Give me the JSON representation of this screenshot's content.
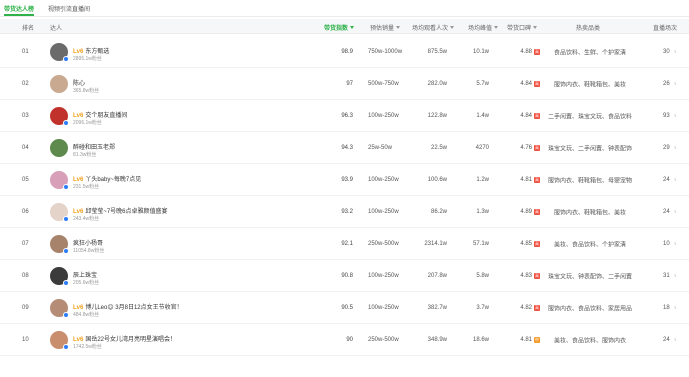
{
  "tabs": [
    {
      "label": "带货达人榜",
      "active": true
    },
    {
      "label": "视频引流直播间",
      "active": false
    }
  ],
  "columns": {
    "rank": "排名",
    "streamer": "达人",
    "score": "带货指数",
    "sales": "预估销量",
    "viewers": "场均观看人次",
    "peak": "场均峰值",
    "reputation": "带货口碑",
    "category": "热卖品类",
    "lives": "直播场次"
  },
  "colors": {
    "accent": "#2fb24a",
    "level": "#f3a01c",
    "rep_high": "#ef4d3c",
    "rep_mid": "#f39b2b",
    "verified": "#2b7cff"
  },
  "chevron": "›",
  "rows": [
    {
      "rank": "01",
      "level": "Lv6",
      "name": "东方甄选",
      "fans": "2895.1w粉丝",
      "score": "98.9",
      "sales": "750w-1000w",
      "viewers": "875.5w",
      "peak": "10.1w",
      "rep": "4.88",
      "rep_tag": "高",
      "category": "食品饮料、生鲜、个护家清",
      "lives": "30",
      "avatar_color": "#6b6b6b",
      "verified": true
    },
    {
      "rank": "02",
      "level": "",
      "name": "陈心",
      "fans": "365.8w粉丝",
      "score": "97",
      "sales": "500w-750w",
      "viewers": "282.0w",
      "peak": "5.7w",
      "rep": "4.84",
      "rep_tag": "高",
      "category": "服饰内衣、鞋靴箱包、美妆",
      "lives": "26",
      "avatar_color": "#c9a98f",
      "verified": false
    },
    {
      "rank": "03",
      "level": "Lv6",
      "name": "交个朋友直播间",
      "fans": "2096.1w粉丝",
      "score": "96.3",
      "sales": "100w-250w",
      "viewers": "122.8w",
      "peak": "1.4w",
      "rep": "4.84",
      "rep_tag": "高",
      "category": "二手闲置、珠宝文玩、食品饮料",
      "lives": "93",
      "avatar_color": "#c0322b",
      "verified": true
    },
    {
      "rank": "04",
      "level": "",
      "name": "醉碰和田玉老郑",
      "fans": "81.3w粉丝",
      "score": "94.3",
      "sales": "25w-50w",
      "viewers": "22.5w",
      "peak": "4270",
      "rep": "4.76",
      "rep_tag": "高",
      "category": "珠宝文玩、二手闲置、钟表配饰",
      "lives": "29",
      "avatar_color": "#5e8a4e",
      "verified": false
    },
    {
      "rank": "05",
      "level": "Lv6",
      "name": "丫头baby~每晚7点见",
      "fans": "231.5w粉丝",
      "score": "93.9",
      "sales": "100w-250w",
      "viewers": "100.6w",
      "peak": "1.2w",
      "rep": "4.81",
      "rep_tag": "高",
      "category": "服饰内衣、鞋靴箱包、母婴宠物",
      "lives": "24",
      "avatar_color": "#d8a0b8",
      "verified": true
    },
    {
      "rank": "06",
      "level": "Lv6",
      "name": "邱莹莹~7号晚6点卓雅颜值盛宴",
      "fans": "243.4w粉丝",
      "score": "93.2",
      "sales": "100w-250w",
      "viewers": "86.2w",
      "peak": "1.3w",
      "rep": "4.89",
      "rep_tag": "高",
      "category": "服饰内衣、鞋靴箱包、美妆",
      "lives": "24",
      "avatar_color": "#e3d3c8",
      "verified": true
    },
    {
      "rank": "07",
      "level": "",
      "name": "疯狂小杨哥",
      "fans": "11054.8w粉丝",
      "score": "92.1",
      "sales": "250w-500w",
      "viewers": "2314.1w",
      "peak": "57.1w",
      "rep": "4.85",
      "rep_tag": "高",
      "category": "美妆、食品饮料、个护家清",
      "lives": "10",
      "avatar_color": "#a7836b",
      "verified": true
    },
    {
      "rank": "08",
      "level": "",
      "name": "辰上珠宝",
      "fans": "205.6w粉丝",
      "score": "90.8",
      "sales": "100w-250w",
      "viewers": "207.8w",
      "peak": "5.8w",
      "rep": "4.83",
      "rep_tag": "高",
      "category": "珠宝文玩、钟表配饰、二手闲置",
      "lives": "31",
      "avatar_color": "#3b3b3b",
      "verified": true
    },
    {
      "rank": "09",
      "level": "Lv6",
      "name": "博儿Leo😊 3月8日12点女王节收官！",
      "fans": "484.8w粉丝",
      "score": "90.5",
      "sales": "100w-250w",
      "viewers": "382.7w",
      "peak": "3.7w",
      "rep": "4.82",
      "rep_tag": "高",
      "category": "服饰内衣、食品饮料、家居用品",
      "lives": "18",
      "avatar_color": "#b58d77",
      "verified": true
    },
    {
      "rank": "10",
      "level": "Lv6",
      "name": "国岳22号女儿湾月亮明星演唱会！",
      "fans": "1742.5w粉丝",
      "score": "90",
      "sales": "250w-500w",
      "viewers": "348.9w",
      "peak": "18.6w",
      "rep": "4.81",
      "rep_tag": "中",
      "category": "美妆、食品饮料、服饰内衣",
      "lives": "24",
      "avatar_color": "#c98e6d",
      "verified": true
    }
  ]
}
